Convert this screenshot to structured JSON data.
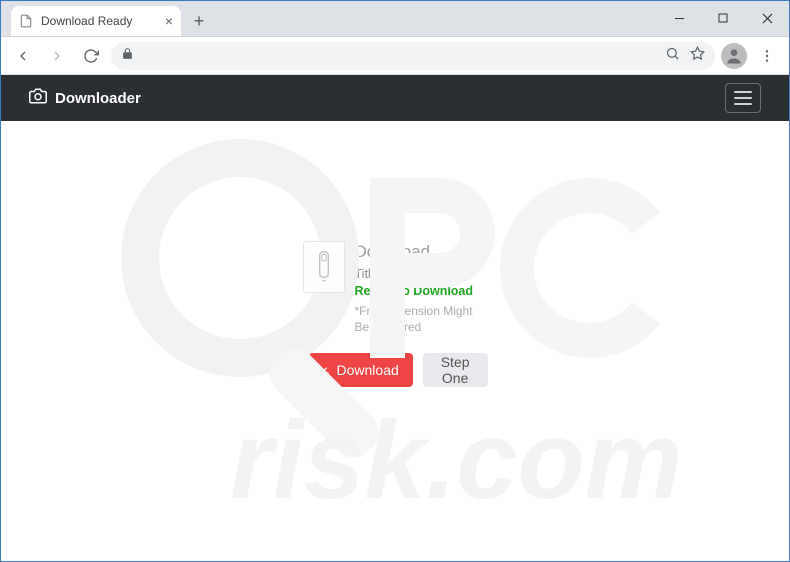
{
  "browser": {
    "tab_title": "Download Ready",
    "url": ""
  },
  "page": {
    "brand": "Downloader",
    "heading": "Download",
    "title_label": "Title",
    "title_value": "Your File Is Ready To Download",
    "note": "*Free Extension Might Be Required",
    "buttons": {
      "download": "Download",
      "step_one": "Step One"
    }
  },
  "colors": {
    "header_bg": "#2b2f33",
    "primary_btn": "#ef4444",
    "secondary_btn": "#e8e9ec",
    "success_text": "#1fa81f"
  }
}
